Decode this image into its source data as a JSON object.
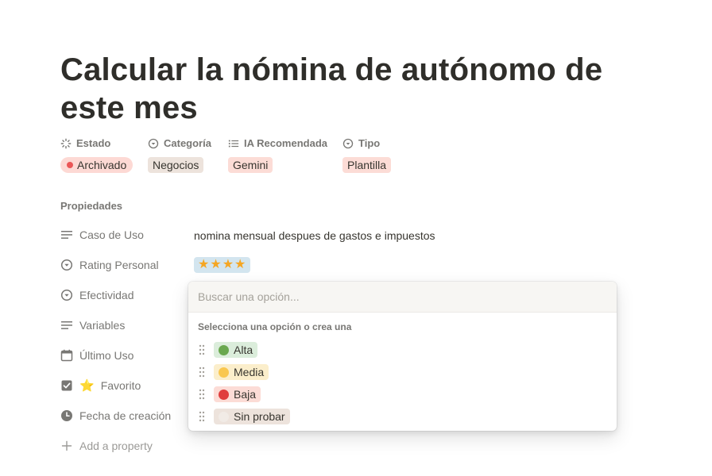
{
  "page": {
    "title": "Calcular la nómina de autónomo de este mes"
  },
  "header_properties": [
    {
      "name": "Estado",
      "icon": "status-icon",
      "value": "Archivado",
      "bg": "#fdd9d4",
      "dot": "#eb5757"
    },
    {
      "name": "Categoría",
      "icon": "select-circle-icon",
      "value": "Negocios",
      "bg": "#ede3dc"
    },
    {
      "name": "IA Recomendada",
      "icon": "multiselect-list-icon",
      "value": "Gemini",
      "bg": "#fcdcd6"
    },
    {
      "name": "Tipo",
      "icon": "select-circle-icon",
      "value": "Plantilla",
      "bg": "#fcdcd6"
    }
  ],
  "properties_section": {
    "title": "Propiedades",
    "rows": [
      {
        "label": "Caso de Uso",
        "icon": "text-lines-icon",
        "value": "nomina mensual despues de gastos e impuestos"
      },
      {
        "label": "Rating Personal",
        "icon": "select-circle-icon",
        "value": "★★★★"
      },
      {
        "label": "Efectividad",
        "icon": "select-circle-icon"
      },
      {
        "label": "Variables",
        "icon": "text-lines-icon"
      },
      {
        "label": "Último Uso",
        "icon": "calendar-icon"
      },
      {
        "label": "Favorito",
        "icon": "checkbox-icon",
        "emoji": "⭐"
      },
      {
        "label": "Fecha de creación",
        "icon": "clock-icon"
      }
    ],
    "add_property": "Add a property"
  },
  "dropdown": {
    "search_placeholder": "Buscar una opción...",
    "hint": "Selecciona una opción o crea una",
    "options": [
      {
        "label": "Alta",
        "color": "#6aa84f",
        "bg": "#dbeddb"
      },
      {
        "label": "Media",
        "color": "#f9c74f",
        "bg": "#fbeecb"
      },
      {
        "label": "Baja",
        "color": "#e03e3e",
        "bg": "#fcdcd6"
      },
      {
        "label": "Sin probar",
        "color": "#f1ebe6",
        "bg": "#ede3dc"
      }
    ]
  }
}
